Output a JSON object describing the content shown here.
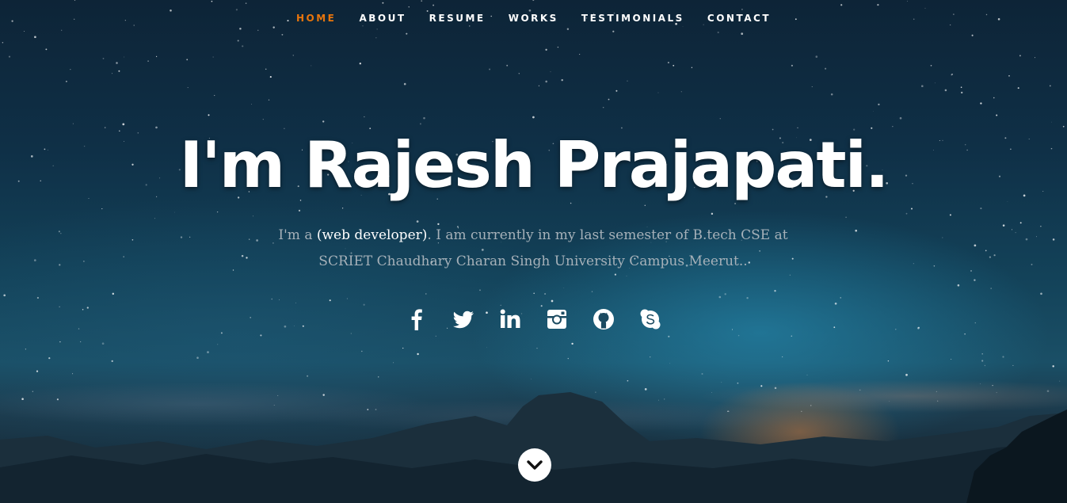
{
  "nav": {
    "items": [
      {
        "label": "HOME",
        "active": true
      },
      {
        "label": "ABOUT",
        "active": false
      },
      {
        "label": "RESUME",
        "active": false
      },
      {
        "label": "WORKS",
        "active": false
      },
      {
        "label": "TESTIMONIALS",
        "active": false
      },
      {
        "label": "CONTACT",
        "active": false
      }
    ],
    "active_color": "#e8750c"
  },
  "hero": {
    "headline": "I'm Rajesh Prajapati.",
    "intro_prefix": "I'm a ",
    "intro_role": "(web developer)",
    "intro_rest": ". I am currently in my last semester of B.tech CSE at SCRIET Chaudhary Charan Singh University Campus Meerut.."
  },
  "social": [
    {
      "icon": "facebook-icon"
    },
    {
      "icon": "twitter-icon"
    },
    {
      "icon": "linkedin-icon"
    },
    {
      "icon": "instagram-icon"
    },
    {
      "icon": "github-icon"
    },
    {
      "icon": "skype-icon"
    }
  ],
  "scroll": {
    "icon": "chevron-down-icon"
  }
}
